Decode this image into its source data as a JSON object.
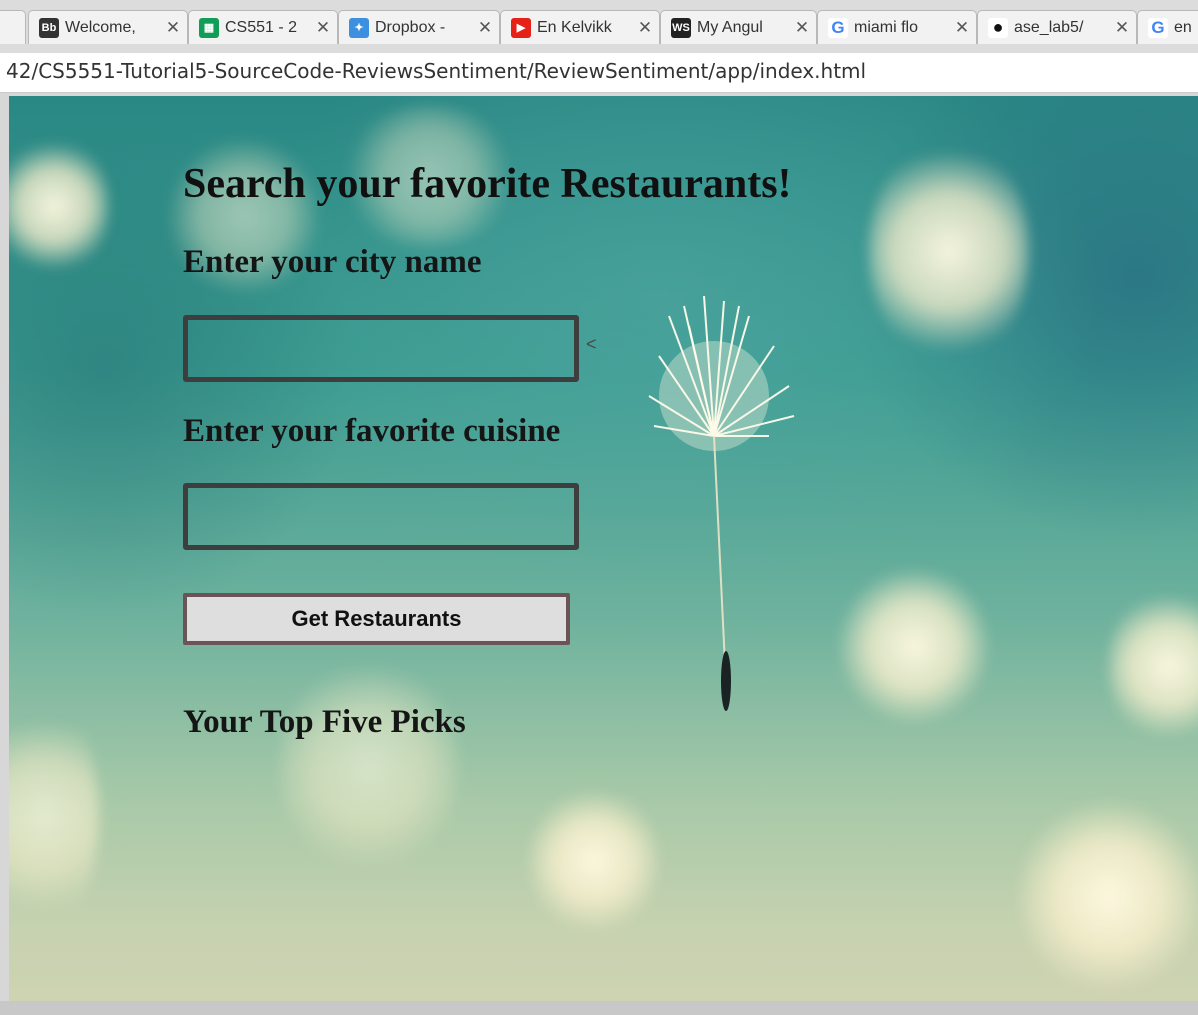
{
  "browser": {
    "tabs": [
      {
        "title": "Welcome,",
        "icon": "blackboard-icon",
        "icon_text": "Bb",
        "icon_color": "#333333"
      },
      {
        "title": "CS551 - 2",
        "icon": "sheets-icon",
        "icon_text": "▦",
        "icon_color": "#0f9d58"
      },
      {
        "title": "Dropbox -",
        "icon": "dropbox-icon",
        "icon_text": "✦",
        "icon_color": "#3d8fe0"
      },
      {
        "title": "En Kelvikk",
        "icon": "youtube-icon",
        "icon_text": "▶",
        "icon_color": "#e62117"
      },
      {
        "title": "My Angul",
        "icon": "webstorm-icon",
        "icon_text": "WS",
        "icon_color": "#222222"
      },
      {
        "title": "miami flo",
        "icon": "google-icon",
        "icon_text": "G",
        "icon_color": "#4285f4"
      },
      {
        "title": "ase_lab5/",
        "icon": "github-icon",
        "icon_text": "●",
        "icon_color": "#111111"
      },
      {
        "title": "en",
        "icon": "google-icon",
        "icon_text": "G",
        "icon_color": "#4285f4"
      }
    ],
    "tab_close_glyph": "✕",
    "url": "42/CS5551-Tutorial5-SourceCode-ReviewsSentiment/ReviewSentiment/app/index.html"
  },
  "page": {
    "heading": "Search your favorite Restaurants!",
    "city_label": "Enter your city name",
    "city_value": "",
    "stray_char": "<",
    "cuisine_label": "Enter your favorite cuisine",
    "cuisine_value": "",
    "button_label": "Get Restaurants",
    "picks_heading": "Your Top Five Picks"
  },
  "colors": {
    "background_teal": "#2a8884",
    "background_pale": "#cfd3b2",
    "input_border": "#3e3e3e",
    "button_border": "#6b5457",
    "button_fill": "#dedede"
  }
}
